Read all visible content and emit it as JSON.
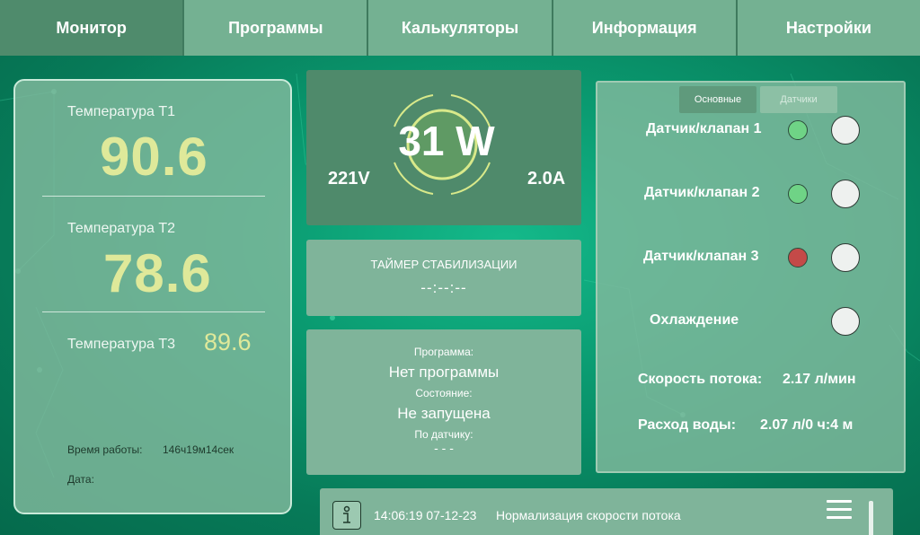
{
  "nav": {
    "tabs": [
      {
        "label": "Монитор",
        "active": true
      },
      {
        "label": "Программы",
        "active": false
      },
      {
        "label": "Калькуляторы",
        "active": false
      },
      {
        "label": "Информация",
        "active": false
      },
      {
        "label": "Настройки",
        "active": false
      }
    ]
  },
  "temperatures": {
    "t1_label": "Температура Т1",
    "t1_value": "90.6",
    "t2_label": "Температура Т2",
    "t2_value": "78.6",
    "t3_label": "Температура Т3",
    "t3_value": "89.6",
    "uptime_label": "Время работы:",
    "uptime_value": "146ч19м14сек",
    "date_label": "Дата:"
  },
  "power": {
    "voltage": "221V",
    "watts": "31 W",
    "current": "2.0A"
  },
  "timer": {
    "title": "ТАЙМЕР СТАБИЛИЗАЦИИ",
    "value": "--:--:--"
  },
  "program": {
    "program_label": "Программа:",
    "program_value": "Нет программы",
    "state_label": "Состояние:",
    "state_value": "Не запущена",
    "sensor_label": "По датчику:",
    "sensor_value": "- - -"
  },
  "sensors_panel": {
    "tabs": [
      "Основные",
      "Датчики"
    ],
    "valves": [
      {
        "label": "Датчик/клапан 1",
        "status_color": "#6fd386"
      },
      {
        "label": "Датчик/клапан 2",
        "status_color": "#6fd386"
      },
      {
        "label": "Датчик/клапан 3",
        "status_color": "#c44a48"
      }
    ],
    "cooling_label": "Охлаждение",
    "flow_label": "Скорость потока:",
    "flow_value": "2.17 л/мин",
    "water_label": "Расход воды:",
    "water_value": "2.07 л/0 ч:4 м"
  },
  "status": {
    "time": "14:06:19 07-12-23",
    "message": "Нормализация скорости потока",
    "icon": "info-icon"
  },
  "colors": {
    "accent_value": "#dfe99a",
    "background": "#0a9a70",
    "led_ok": "#6fd386",
    "led_error": "#c44a48"
  }
}
